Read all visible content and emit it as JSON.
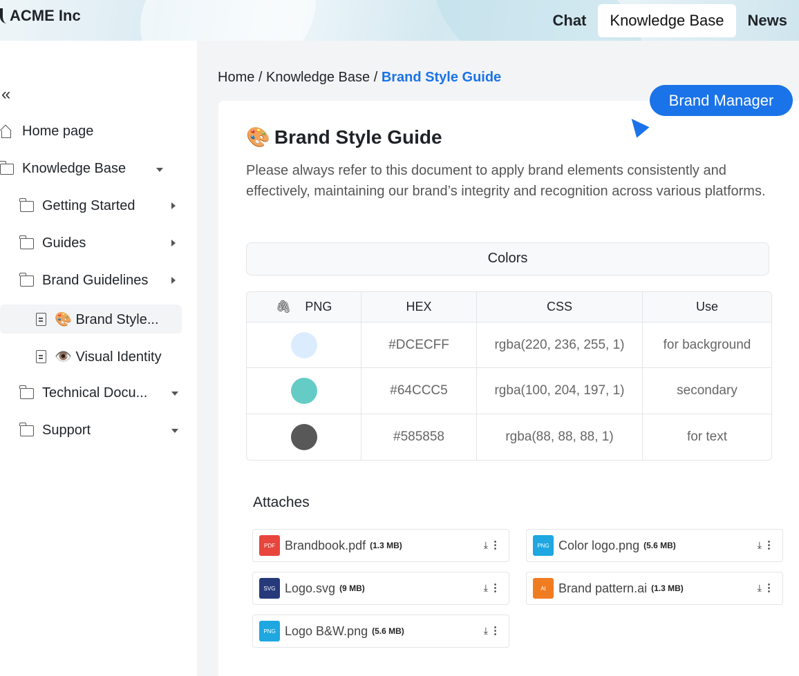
{
  "header": {
    "brand": "ACME Inc",
    "nav": [
      {
        "label": "Chat"
      },
      {
        "label": "Knowledge Base"
      },
      {
        "label": "News"
      }
    ]
  },
  "sidebar": {
    "collapse_glyph": "«",
    "items": [
      {
        "label": "Home page",
        "icon": "home-icon"
      },
      {
        "label": "Knowledge Base",
        "icon": "folder-icon"
      },
      {
        "label": "Getting Started",
        "icon": "folder-icon"
      },
      {
        "label": "Guides",
        "icon": "folder-icon"
      },
      {
        "label": "Brand Guidelines",
        "icon": "folder-icon"
      },
      {
        "label": "🎨 Brand Style...",
        "icon": "document-icon"
      },
      {
        "label": "👁️ Visual Identity",
        "icon": "document-icon"
      },
      {
        "label": "Technical Docu...",
        "icon": "folder-icon"
      },
      {
        "label": "Support",
        "icon": "folder-icon"
      }
    ]
  },
  "breadcrumb": {
    "home": "Home",
    "sep1": " / ",
    "section": "Knowledge Base",
    "sep2": " / ",
    "current": "Brand Style Guide"
  },
  "badge": "Brand Manager",
  "doc": {
    "emoji": "🎨",
    "title": "Brand Style Guide",
    "intro": "Please always refer to this document to apply brand elements consistently and effectively, maintaining our brand’s integrity and recognition across various platforms."
  },
  "colors_section": "Colors",
  "table": {
    "headers": [
      "PNG",
      "HEX",
      "CSS",
      "Use"
    ],
    "rows": [
      {
        "swatch": "#DCECFF",
        "hex": "#DCECFF",
        "css": "rgba(220, 236, 255, 1)",
        "use": "for background"
      },
      {
        "swatch": "#64CCC5",
        "hex": "#64CCC5",
        "css": "rgba(100, 204, 197, 1)",
        "use": "secondary"
      },
      {
        "swatch": "#585858",
        "hex": "#585858",
        "css": "rgba(88, 88, 88, 1)",
        "use": "for text"
      }
    ]
  },
  "attaches": {
    "title": "Attaches",
    "files": [
      {
        "type": "PDF",
        "name": "Brandbook.pdf",
        "size": "(1.3 MB)",
        "color": "#e8453c"
      },
      {
        "type": "PNG",
        "name": "Color logo.png",
        "size": "(5.6 MB)",
        "color": "#1ea7e0"
      },
      {
        "type": "SVG",
        "name": "Logo.svg",
        "size": "(9 MB)",
        "color": "#26397a"
      },
      {
        "type": "AI",
        "name": "Brand pattern.ai",
        "size": "(1.3 MB)",
        "color": "#f07c22"
      },
      {
        "type": "PNG",
        "name": "Logo B&W.png",
        "size": "(5.6 MB)",
        "color": "#1ea7e0"
      }
    ]
  }
}
